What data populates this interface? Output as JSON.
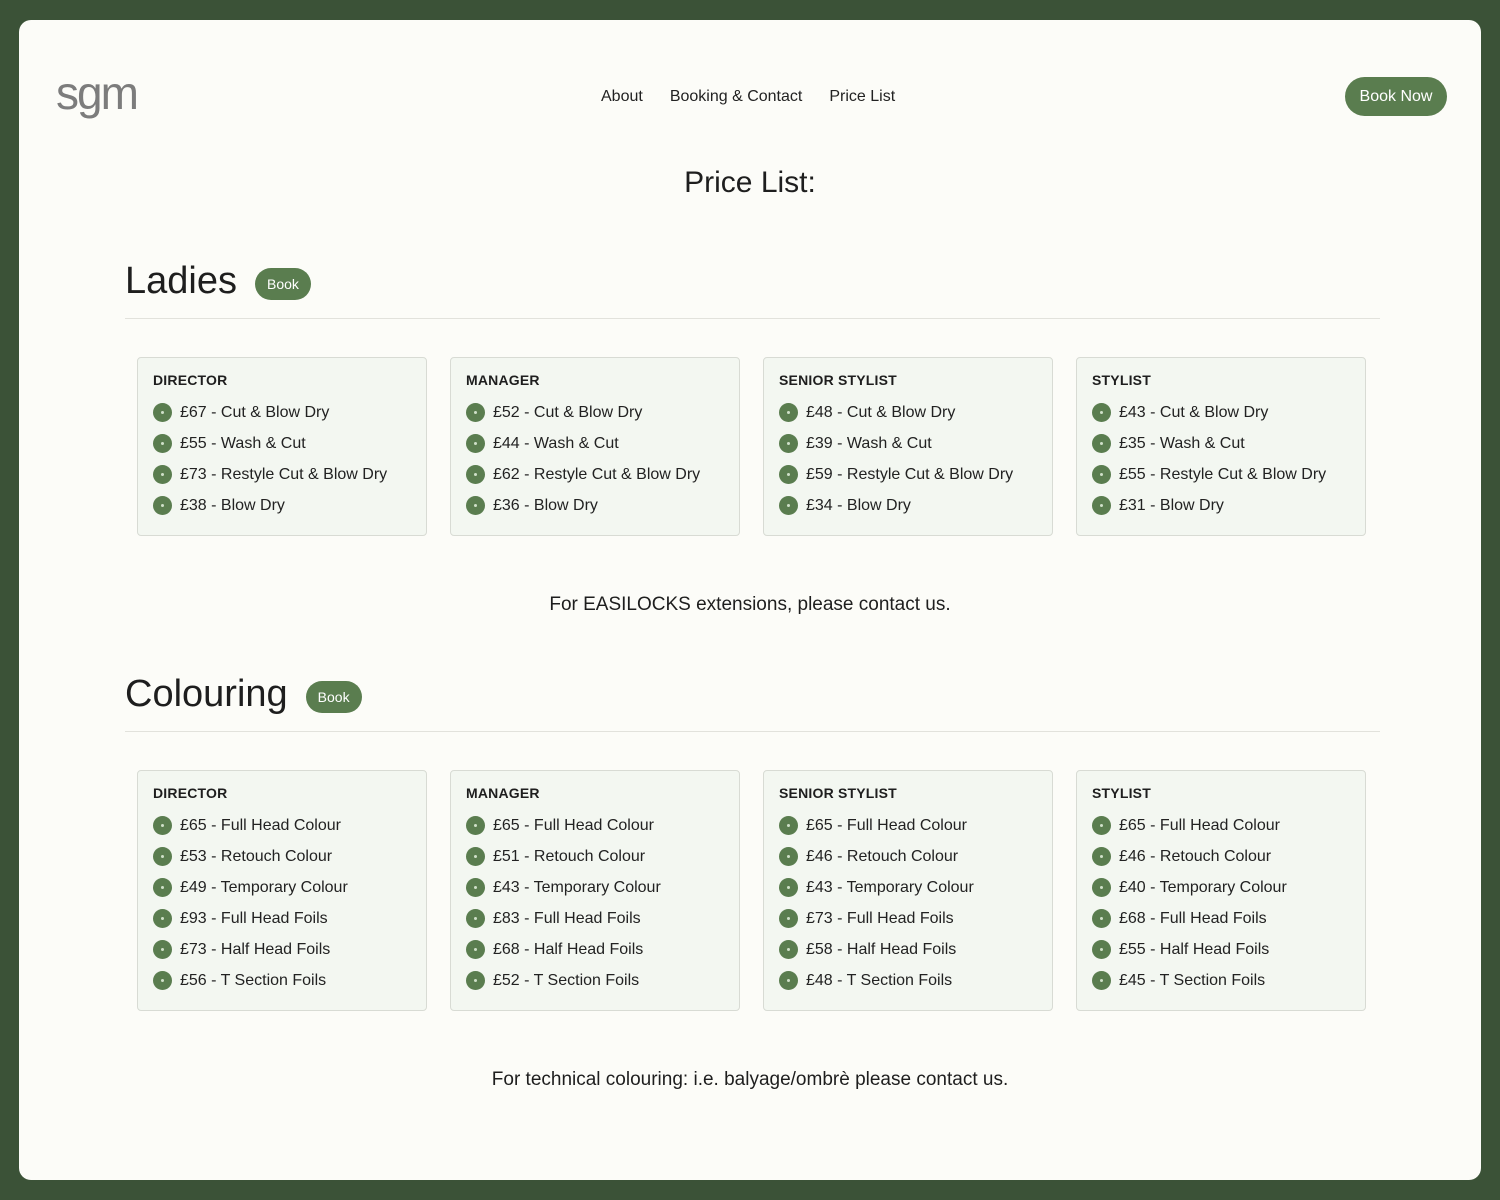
{
  "header": {
    "logo": "sgm",
    "nav": [
      "About",
      "Booking & Contact",
      "Price List"
    ],
    "book_now": "Book Now"
  },
  "page_title": "Price List:",
  "ladies": {
    "title": "Ladies",
    "book_label": "Book",
    "cards": [
      {
        "role": "DIRECTOR",
        "items": [
          "£67 - Cut & Blow Dry",
          "£55 - Wash & Cut",
          "£73 - Restyle Cut & Blow Dry",
          "£38 - Blow Dry"
        ]
      },
      {
        "role": "MANAGER",
        "items": [
          "£52 - Cut & Blow Dry",
          "£44 - Wash & Cut",
          "£62 - Restyle Cut & Blow Dry",
          "£36 - Blow Dry"
        ]
      },
      {
        "role": "SENIOR STYLIST",
        "items": [
          "£48 - Cut & Blow Dry",
          "£39 - Wash & Cut",
          "£59 - Restyle Cut & Blow Dry",
          "£34 - Blow Dry"
        ]
      },
      {
        "role": "STYLIST",
        "items": [
          "£43 - Cut & Blow Dry",
          "£35 - Wash & Cut",
          "£55 - Restyle Cut & Blow Dry",
          "£31 - Blow Dry"
        ]
      }
    ],
    "note": "For EASILOCKS extensions, please contact us."
  },
  "colouring": {
    "title": "Colouring",
    "book_label": "Book",
    "cards": [
      {
        "role": "DIRECTOR",
        "items": [
          "£65 - Full Head Colour",
          "£53 - Retouch Colour",
          "£49 - Temporary Colour",
          "£93 - Full Head Foils",
          "£73 - Half Head Foils",
          "£56 - T Section Foils"
        ]
      },
      {
        "role": "MANAGER",
        "items": [
          "£65 - Full Head Colour",
          "£51 - Retouch Colour",
          "£43 - Temporary Colour",
          "£83 - Full Head Foils",
          "£68 - Half Head Foils",
          "£52 - T Section Foils"
        ]
      },
      {
        "role": "SENIOR STYLIST",
        "items": [
          "£65 - Full Head Colour",
          "£46 - Retouch Colour",
          "£43 - Temporary Colour",
          "£73 - Full Head Foils",
          "£58 - Half Head Foils",
          "£48 - T Section Foils"
        ]
      },
      {
        "role": "STYLIST",
        "items": [
          "£65 - Full Head Colour",
          "£46 - Retouch Colour",
          "£40 - Temporary Colour",
          "£68 - Full Head Foils",
          "£55 - Half Head Foils",
          "£45 - T Section Foils"
        ]
      }
    ],
    "note": "For technical colouring: i.e. balyage/ombrè please contact us."
  },
  "colors": {
    "accent": "#5a7d4f",
    "frame": "#3b5237",
    "page": "#fcfcf8",
    "card": "#f3f7f1"
  }
}
